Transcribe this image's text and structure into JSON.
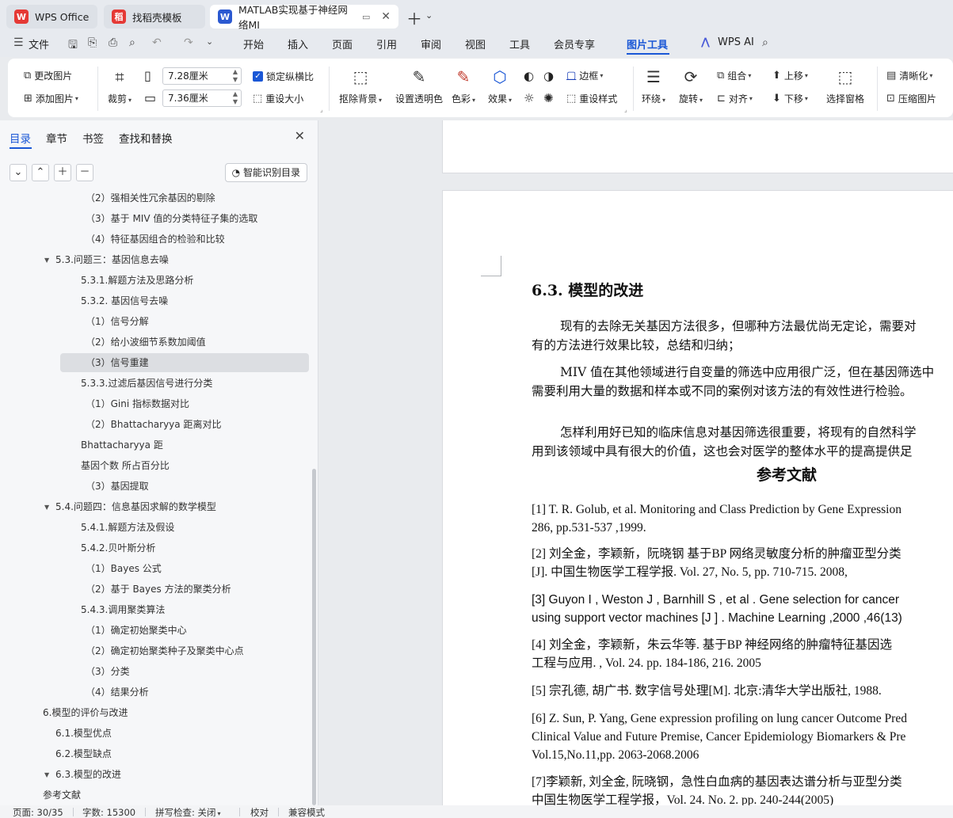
{
  "tabs": [
    {
      "label": "WPS Office",
      "logo_text": "W",
      "logo_color": "#e53935"
    },
    {
      "label": "找稻壳模板",
      "logo_text": "稻",
      "logo_color": "#e53935"
    },
    {
      "label": "MATLAB实现基于神经网络MI",
      "logo_text": "W",
      "logo_color": "#2b59d1"
    }
  ],
  "menu": {
    "file": "文件",
    "items": [
      "开始",
      "插入",
      "页面",
      "引用",
      "审阅",
      "视图",
      "工具",
      "会员专享",
      "图片工具",
      "WPS AI"
    ],
    "active": "图片工具"
  },
  "ribbon": {
    "change_pic": "更改图片",
    "add_pic": "添加图片",
    "crop": "裁剪",
    "width": "7.28厘米",
    "height": "7.36厘米",
    "lock_ratio": "锁定纵横比",
    "reset_size": "重设大小",
    "remove_bg": "抠除背景",
    "set_transparent": "设置透明色",
    "color": "色彩",
    "effect": "效果",
    "border": "边框",
    "reset_style": "重设样式",
    "wrap": "环绕",
    "rotate": "旋转",
    "group": "组合",
    "align": "对齐",
    "bring_forward": "上移",
    "send_backward": "下移",
    "select_pane": "选择窗格",
    "sharpen": "清晰化",
    "compress": "压缩图片"
  },
  "panel": {
    "tabs": [
      "目录",
      "章节",
      "书签",
      "查找和替换"
    ],
    "smart_toc": "智能识别目录",
    "toc": [
      {
        "label": "（2）强相关性冗余基因的剔除",
        "indent": 3
      },
      {
        "label": "（3）基于 MIV 值的分类特征子集的选取",
        "indent": 3
      },
      {
        "label": "（4）特征基因组合的检验和比较",
        "indent": 3
      },
      {
        "label": "5.3.问题三：基因信息去噪",
        "indent": 1,
        "expand": true
      },
      {
        "label": "5.3.1.解题方法及思路分析",
        "indent": 2
      },
      {
        "label": "5.3.2. 基因信号去噪",
        "indent": 2
      },
      {
        "label": "（1）信号分解",
        "indent": 3
      },
      {
        "label": "（2）给小波细节系数加阈值",
        "indent": 3
      },
      {
        "label": "（3）信号重建",
        "indent": 3,
        "selected": true
      },
      {
        "label": "5.3.3.过滤后基因信号进行分类",
        "indent": 2
      },
      {
        "label": "（1）Gini 指标数据对比",
        "indent": 3
      },
      {
        "label": "（2）Bhattacharyya 距离对比",
        "indent": 3
      },
      {
        "label": "Bhattacharyya 距",
        "indent": 2
      },
      {
        "label": "基因个数 所占百分比",
        "indent": 2
      },
      {
        "label": "（3）基因提取",
        "indent": 3
      },
      {
        "label": "5.4.问题四：信息基因求解的数学模型",
        "indent": 1,
        "expand": true
      },
      {
        "label": "5.4.1.解题方法及假设",
        "indent": 2
      },
      {
        "label": "5.4.2.贝叶斯分析",
        "indent": 2
      },
      {
        "label": "（1）Bayes 公式",
        "indent": 3
      },
      {
        "label": "（2）基于 Bayes 方法的聚类分析",
        "indent": 3
      },
      {
        "label": "5.4.3.调用聚类算法",
        "indent": 2
      },
      {
        "label": "（1）确定初始聚类中心",
        "indent": 3
      },
      {
        "label": "（2）确定初始聚类种子及聚类中心点",
        "indent": 3
      },
      {
        "label": "（3）分类",
        "indent": 3
      },
      {
        "label": "（4）结果分析",
        "indent": 3
      },
      {
        "label": "6.模型的评价与改进",
        "indent": 0
      },
      {
        "label": "6.1.模型优点",
        "indent": 1
      },
      {
        "label": "6.2.模型缺点",
        "indent": 1
      },
      {
        "label": "6.3.模型的改进",
        "indent": 1,
        "expand": true
      },
      {
        "label": "参考文献",
        "indent": 0
      }
    ]
  },
  "doc": {
    "heading": "6.3. 模型的改进",
    "paragraphs": [
      [
        "现有的去除无关基因方法很多，但哪种方法最优尚无定论，需要对",
        "有的方法进行效果比较，总结和归纳；"
      ],
      [
        "MIV 值在其他领域进行自变量的筛选中应用很广泛，但在基因筛选中",
        "需要利用大量的数据和样本或不同的案例对该方法的有效性进行检验。"
      ],
      [
        "怎样利用好已知的临床信息对基因筛选很重要，将现有的自然科学",
        "用到该领域中具有很大的价值，这也会对医学的整体水平的提高提供足"
      ]
    ],
    "ref_title": "参考文献",
    "refs": [
      [
        "[1] T. R. Golub, et al. Monitoring and Class Prediction by Gene Expression",
        "286, pp.531-537 ,1999."
      ],
      [
        "[2]  刘全金，李颖新，阮晓钢  基于BP  网络灵敏度分析的肿瘤亚型分类",
        "[J]. 中国生物医学工程学报.  Vol. 27, No. 5, pp. 710-715.   2008,"
      ],
      [
        "[3] Guyon I , Weston J , Barnhill S , et al . Gene selection for cancer",
        "using support vector machines [J ] . Machine Learning ,2000 ,46(13)"
      ],
      [
        "[4]  刘全金，李颖新，朱云华等.  基于BP  神经网络的肿瘤特征基因选",
        "工程与应用. , Vol. 24. pp. 184-186, 216.   2005"
      ],
      [
        "[5]  宗孔德, 胡广书. 数字信号处理[M]. 北京:清华大学出版社,  1988."
      ],
      [
        "[6] Z. Sun, P. Yang, Gene expression profiling on lung cancer Outcome Pred",
        "Clinical Value and Future Premise, Cancer Epidemiology Biomarkers & Pre",
        "Vol.15,No.11,pp. 2063-2068.2006"
      ],
      [
        "[7]李颖新, 刘全金, 阮晓钢，急性白血病的基因表达谱分析与亚型分类",
        "中国生物医学工程学报，Vol. 24.   No. 2.   pp. 240-244(2005)"
      ]
    ]
  },
  "status": {
    "page": "页面: 30/35",
    "words": "字数: 15300",
    "spell": "拼写检查: 关闭",
    "proof": "校对",
    "compat": "兼容模式"
  },
  "colors": {
    "accent": "#1a57d6"
  }
}
